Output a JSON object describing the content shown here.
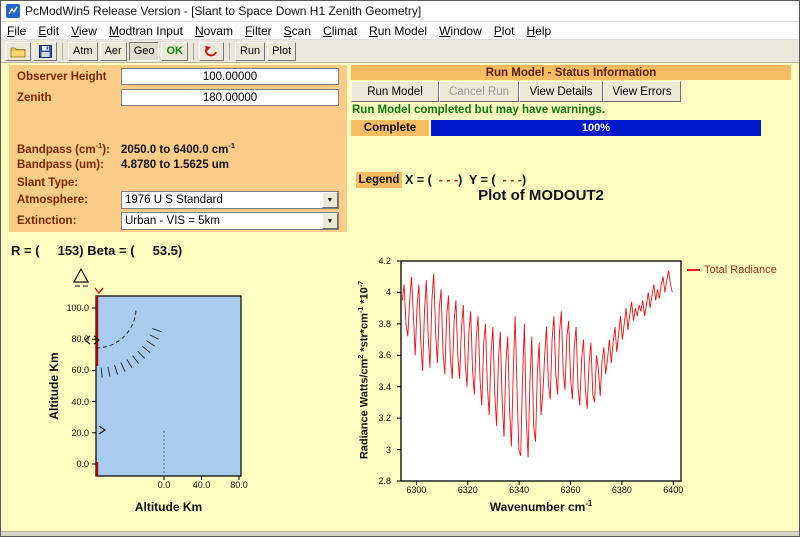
{
  "window": {
    "title": "PcModWin5 Release Version  - [Slant to Space Down H1 Zenith Geometry]"
  },
  "menu": {
    "items": [
      "File",
      "Edit",
      "View",
      "Modtran Input",
      "Novam",
      "Filter",
      "Scan",
      "Climat",
      "Run Model",
      "Window",
      "Plot",
      "Help"
    ]
  },
  "toolbar": {
    "atm": "Atm",
    "aer": "Aer",
    "geo": "Geo",
    "ok": "OK",
    "run": "Run",
    "plot": "Plot"
  },
  "params": {
    "observer_height": {
      "label": "Observer Height",
      "value": "100.00000"
    },
    "zenith": {
      "label": "Zenith",
      "value": "180.00000"
    },
    "bandpass_cm": {
      "label": "Bandpass (cm^-1):",
      "value": "2050.0 to 6400.0 cm^-1"
    },
    "bandpass_um": {
      "label": "Bandpass (um):",
      "value": "4.8780 to 1.5625 um"
    },
    "slant_type": {
      "label": "Slant Type:",
      "value": ""
    },
    "atmosphere": {
      "label": "Atmosphere:",
      "value": "1976 U S Standard"
    },
    "extinction": {
      "label": "Extinction:",
      "value": "Urban - VIS = 5km"
    }
  },
  "status": {
    "header": "Run Model - Status Information",
    "run_button": "Run Model",
    "cancel_button": "Cancel Run",
    "details_button": "View Details",
    "errors_button": "View Errors",
    "message": "Run Model completed but may have warnings.",
    "complete_label": "Complete",
    "progress_text": "100%"
  },
  "legend_bar": {
    "chip": "Legend",
    "x_prefix": "X = ( ",
    "dashes": " - - -",
    "y_prefix": ")  Y = ( ",
    "suffix": ")"
  },
  "geometry": {
    "r_beta_text": "R = (     153) Beta = (     53.5)",
    "xlabel": "Altitude Km",
    "ylabel": "Altitude Km",
    "yticks": [
      "100.0",
      "80.0",
      "60.0",
      "40.0",
      "20.0",
      "0.0"
    ],
    "xticks": [
      "0.0",
      "40.0",
      "80.0"
    ]
  },
  "chart_data": {
    "type": "line",
    "title": "Plot of MODOUT2",
    "xlabel": "Wavenumber cm^-1",
    "ylabel": "Radiance Watts/cm^2 *str*cm^-1  *10^-7",
    "legend": "Total Radiance",
    "legend_position": "top-right",
    "line_color": "#EE1111",
    "grid": false,
    "xlim": [
      6294,
      6403
    ],
    "ylim": [
      2.8,
      4.2
    ],
    "xticks": [
      6300,
      6320,
      6340,
      6360,
      6380,
      6400
    ],
    "yticks": [
      4.2,
      4.0,
      3.8,
      3.6,
      3.4,
      3.2,
      3.0,
      2.8
    ],
    "ytick_labels": [
      "4.2",
      "4",
      "3.8",
      "3.6",
      "3.4",
      "3.2",
      "3",
      "2.8"
    ],
    "x_start": 6294.5,
    "x_step": 0.72,
    "y_values": [
      3.95,
      4.05,
      3.8,
      3.72,
      3.95,
      4.1,
      3.85,
      3.6,
      3.92,
      4.05,
      3.68,
      3.5,
      3.88,
      4.08,
      3.72,
      3.52,
      3.95,
      4.12,
      3.75,
      3.55,
      3.9,
      4.02,
      3.62,
      3.48,
      3.85,
      3.98,
      3.58,
      3.45,
      3.82,
      3.95,
      3.6,
      3.45,
      3.78,
      3.92,
      3.55,
      3.4,
      3.75,
      3.88,
      3.5,
      3.35,
      3.72,
      3.85,
      3.45,
      3.28,
      3.68,
      3.8,
      3.4,
      3.22,
      3.62,
      3.78,
      3.35,
      3.15,
      3.58,
      3.75,
      3.3,
      3.08,
      3.55,
      3.72,
      3.25,
      3.02,
      3.5,
      3.85,
      3.4,
      3.0,
      2.96,
      3.45,
      3.8,
      3.2,
      2.95,
      3.42,
      3.72,
      3.15,
      3.05,
      3.48,
      3.68,
      3.22,
      3.35,
      3.6,
      3.78,
      3.42,
      3.32,
      3.7,
      3.85,
      3.48,
      3.35,
      3.75,
      3.88,
      3.5,
      3.38,
      3.72,
      3.82,
      3.45,
      3.32,
      3.65,
      3.78,
      3.4,
      3.28,
      3.58,
      3.7,
      3.38,
      3.26,
      3.55,
      3.68,
      3.35,
      3.3,
      3.6,
      3.52,
      3.34,
      3.56,
      3.65,
      3.48,
      3.58,
      3.7,
      3.55,
      3.68,
      3.78,
      3.62,
      3.74,
      3.85,
      3.7,
      3.8,
      3.9,
      3.76,
      3.86,
      3.94,
      3.82,
      3.9,
      3.85,
      3.92,
      3.88,
      3.95,
      3.85,
      3.92,
      4.0,
      3.9,
      3.98,
      4.05,
      3.95,
      4.02,
      3.96,
      4.05,
      4.1,
      4.0,
      4.08,
      4.14,
      4.05,
      4.0
    ]
  }
}
